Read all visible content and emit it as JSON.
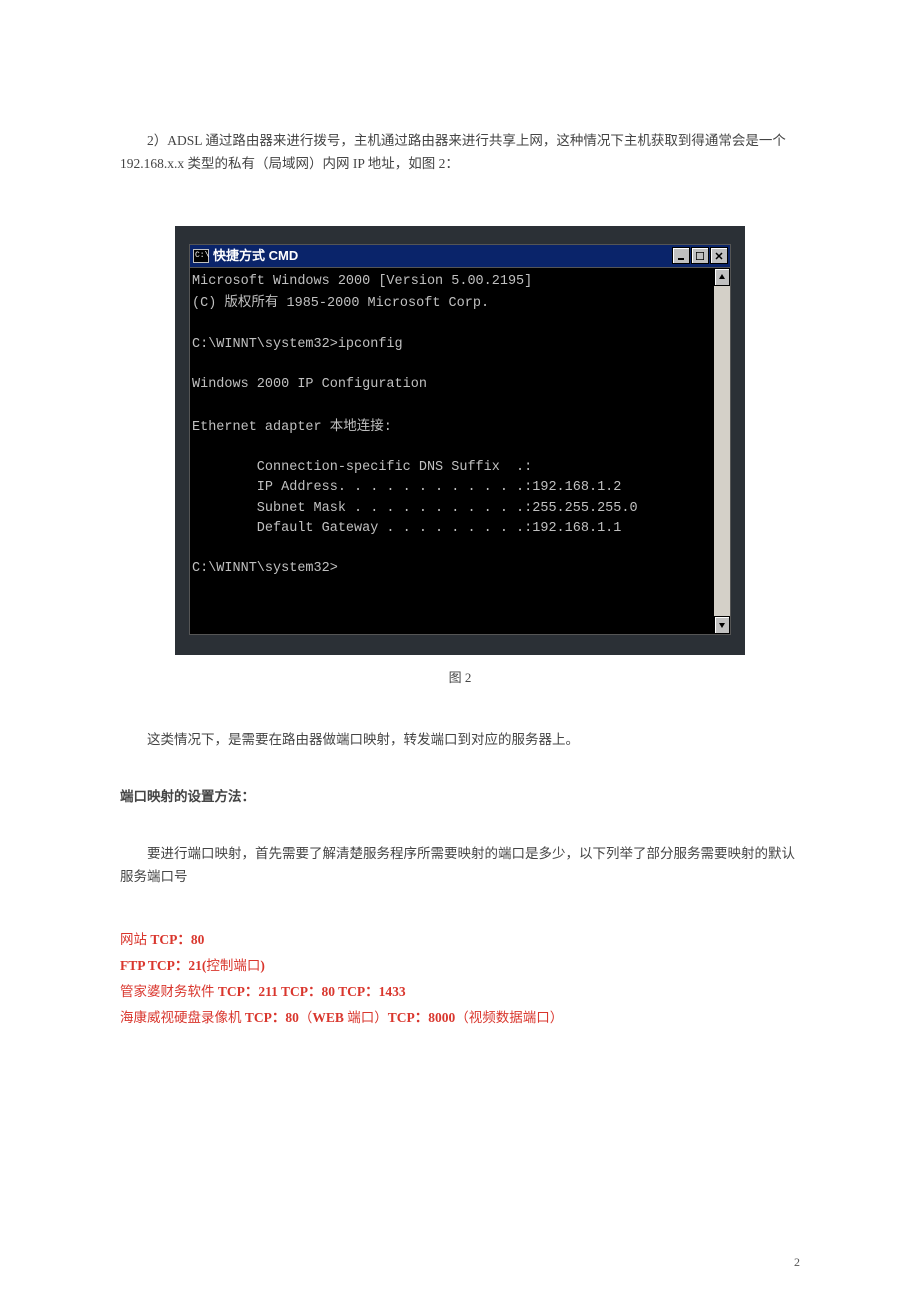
{
  "para1": "2）ADSL 通过路由器来进行拨号，主机通过路由器来进行共享上网，这种情况下主机获取到得通常会是一个 192.168.x.x 类型的私有（局域网）内网 IP 地址，如图 2：",
  "cmd": {
    "title": "快捷方式 CMD",
    "icon_label": "C:\\",
    "lines": {
      "l1": "Microsoft Windows 2000 [Version 5.00.2195]",
      "l2a": "(C) ",
      "l2b": "版权所有",
      "l2c": " 1985-2000 Microsoft Corp.",
      "l3": "C:\\WINNT\\system32>ipconfig",
      "l4": "Windows 2000 IP Configuration",
      "l5a": "Ethernet adapter ",
      "l5b": "本地连接",
      "l5c": ":",
      "l6": "        Connection-specific DNS Suffix  .:",
      "l7": "        IP Address. . . . . . . . . . . .:192.168.1.2",
      "l8": "        Subnet Mask . . . . . . . . . . .:255.255.255.0",
      "l9": "        Default Gateway . . . . . . . . .:192.168.1.1",
      "l10": "C:\\WINNT\\system32>"
    }
  },
  "caption": "图 2",
  "para2": "这类情况下，是需要在路由器做端口映射，转发端口到对应的服务器上。",
  "heading": "端口映射的设置方法：",
  "para3": "要进行端口映射，首先需要了解清楚服务程序所需要映射的端口是多少，以下列举了部分服务需要映射的默认服务端口号",
  "ports": {
    "p1a": "网站",
    "p1b": " TCP：80",
    "p2a": "FTP TCP：21(",
    "p2b": "控制端口",
    "p2c": ")",
    "p3a": "管家婆财务软件",
    "p3b": " TCP：211 TCP：80 TCP：1433",
    "p4a": "海康威视硬盘录像机",
    "p4b": " TCP：80",
    "p4c": "（",
    "p4d": "WEB ",
    "p4e": "端口）",
    "p4f": "TCP：8000",
    "p4g": "（视频数据端口）"
  },
  "page_number": "2"
}
